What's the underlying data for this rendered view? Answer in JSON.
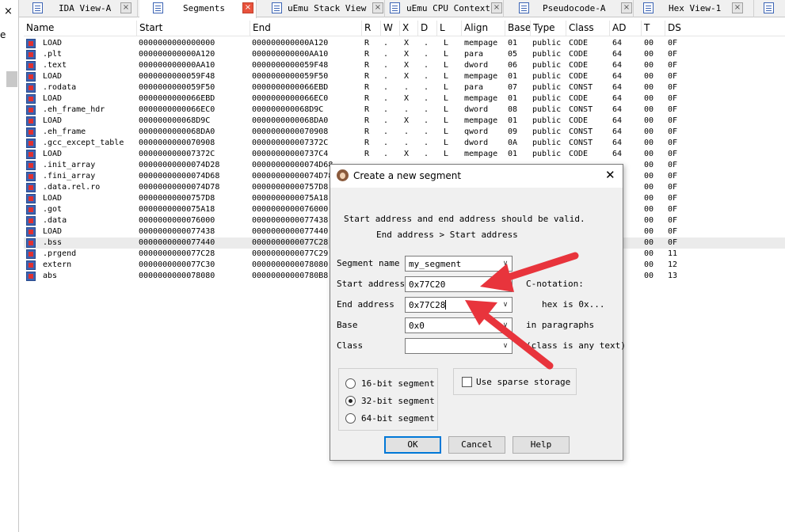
{
  "left_strip": {
    "close_glyph": "×",
    "partial_label": "e"
  },
  "tabs": [
    {
      "label": "IDA View-A",
      "active": false
    },
    {
      "label": "Segments",
      "active": true
    },
    {
      "label": "uEmu Stack View",
      "active": false
    },
    {
      "label": "uEmu CPU Context",
      "active": false
    },
    {
      "label": "Pseudocode-A",
      "active": false
    },
    {
      "label": "Hex View-1",
      "active": false
    }
  ],
  "tab_close_glyph": "×",
  "columns": [
    "Name",
    "Start",
    "End",
    "R",
    "W",
    "X",
    "D",
    "L",
    "Align",
    "Base",
    "Type",
    "Class",
    "AD",
    "T",
    "DS"
  ],
  "rows": [
    [
      "LOAD",
      "0000000000000000",
      "000000000000A120",
      "R",
      ".",
      "X",
      ".",
      "L",
      "mempage",
      "01",
      "public",
      "CODE",
      "64",
      "00",
      "0F"
    ],
    [
      ".plt",
      "000000000000A120",
      "000000000000AA10",
      "R",
      ".",
      "X",
      ".",
      "L",
      "para",
      "05",
      "public",
      "CODE",
      "64",
      "00",
      "0F"
    ],
    [
      ".text",
      "000000000000AA10",
      "0000000000059F48",
      "R",
      ".",
      "X",
      ".",
      "L",
      "dword",
      "06",
      "public",
      "CODE",
      "64",
      "00",
      "0F"
    ],
    [
      "LOAD",
      "0000000000059F48",
      "0000000000059F50",
      "R",
      ".",
      "X",
      ".",
      "L",
      "mempage",
      "01",
      "public",
      "CODE",
      "64",
      "00",
      "0F"
    ],
    [
      ".rodata",
      "0000000000059F50",
      "0000000000066EBD",
      "R",
      ".",
      ".",
      ".",
      "L",
      "para",
      "07",
      "public",
      "CONST",
      "64",
      "00",
      "0F"
    ],
    [
      "LOAD",
      "0000000000066EBD",
      "0000000000066EC0",
      "R",
      ".",
      "X",
      ".",
      "L",
      "mempage",
      "01",
      "public",
      "CODE",
      "64",
      "00",
      "0F"
    ],
    [
      ".eh_frame_hdr",
      "0000000000066EC0",
      "000000000068D9C",
      "R",
      ".",
      ".",
      ".",
      "L",
      "dword",
      "08",
      "public",
      "CONST",
      "64",
      "00",
      "0F"
    ],
    [
      "LOAD",
      "000000000068D9C",
      "0000000000068DA0",
      "R",
      ".",
      "X",
      ".",
      "L",
      "mempage",
      "01",
      "public",
      "CODE",
      "64",
      "00",
      "0F"
    ],
    [
      ".eh_frame",
      "0000000000068DA0",
      "0000000000070908",
      "R",
      ".",
      ".",
      ".",
      "L",
      "qword",
      "09",
      "public",
      "CONST",
      "64",
      "00",
      "0F"
    ],
    [
      ".gcc_except_table",
      "0000000000070908",
      "000000000007372C",
      "R",
      ".",
      ".",
      ".",
      "L",
      "dword",
      "0A",
      "public",
      "CONST",
      "64",
      "00",
      "0F"
    ],
    [
      "LOAD",
      "000000000007372C",
      "00000000000737C4",
      "R",
      ".",
      "X",
      ".",
      "L",
      "mempage",
      "01",
      "public",
      "CODE",
      "64",
      "00",
      "0F"
    ],
    [
      ".init_array",
      "00000000000074D28",
      "00000000000074D68",
      "",
      "",
      "",
      "",
      "",
      "",
      "",
      "",
      "",
      "",
      "00",
      "0F"
    ],
    [
      ".fini_array",
      "00000000000074D68",
      "00000000000074D78",
      "",
      "",
      "",
      "",
      "",
      "",
      "",
      "",
      "",
      "",
      "00",
      "0F"
    ],
    [
      ".data.rel.ro",
      "00000000000074D78",
      "00000000000757D8",
      "",
      "",
      "",
      "",
      "",
      "",
      "",
      "",
      "",
      "",
      "00",
      "0F"
    ],
    [
      "LOAD",
      "00000000000757D8",
      "0000000000075A18",
      "",
      "",
      "",
      "",
      "",
      "",
      "",
      "",
      "",
      "",
      "00",
      "0F"
    ],
    [
      ".got",
      "0000000000075A18",
      "0000000000076000",
      "",
      "",
      "",
      "",
      "",
      "",
      "",
      "",
      "",
      "",
      "00",
      "0F"
    ],
    [
      ".data",
      "0000000000076000",
      "0000000000077438",
      "",
      "",
      "",
      "",
      "",
      "",
      "",
      "",
      "",
      "",
      "00",
      "0F"
    ],
    [
      "LOAD",
      "0000000000077438",
      "0000000000077440",
      "",
      "",
      "",
      "",
      "",
      "",
      "",
      "",
      "",
      "",
      "00",
      "0F"
    ],
    [
      ".bss",
      "0000000000077440",
      "0000000000077C28",
      "",
      "",
      "",
      "",
      "",
      "",
      "",
      "",
      "",
      "",
      "00",
      "0F"
    ],
    [
      ".prgend",
      "0000000000077C28",
      "0000000000077C29",
      "",
      "",
      "",
      "",
      "",
      "",
      "",
      "",
      "",
      "",
      "00",
      "11"
    ],
    [
      "extern",
      "0000000000077C30",
      "0000000000078080",
      "",
      "",
      "",
      "",
      "",
      "",
      "",
      "",
      "",
      "",
      "00",
      "12"
    ],
    [
      "abs",
      "0000000000078080",
      "00000000000780B8",
      "",
      "",
      "",
      "",
      "",
      "",
      "",
      "",
      "",
      "",
      "00",
      "13"
    ]
  ],
  "selected_row": 18,
  "dialog": {
    "title": "Create a new segment",
    "close": "✕",
    "info_line1": "Start address and end address should be valid.",
    "info_line2": "End address > Start address",
    "fields": {
      "name_label": "Segment name",
      "name_value": "my_segment",
      "start_label": "Start address",
      "start_value": "0x77C20",
      "end_label": "End address",
      "end_value": "0x77C28",
      "base_label": "Base",
      "base_value": "0x0",
      "class_label": "Class",
      "class_value": ""
    },
    "hints": {
      "c_notation": "C-notation:",
      "hex": "hex is 0x...",
      "paragraphs": "in paragraphs",
      "class_hint": "(class is any text)"
    },
    "bitness": [
      {
        "label": "16-bit segment",
        "selected": false
      },
      {
        "label": "32-bit segment",
        "selected": true
      },
      {
        "label": "64-bit segment",
        "selected": false
      }
    ],
    "sparse": {
      "label": "Use sparse storage",
      "checked": false
    },
    "buttons": {
      "ok": "OK",
      "cancel": "Cancel",
      "help": "Help"
    },
    "dropdown_arrow": "∨"
  },
  "annotation_color": "#e8343c"
}
